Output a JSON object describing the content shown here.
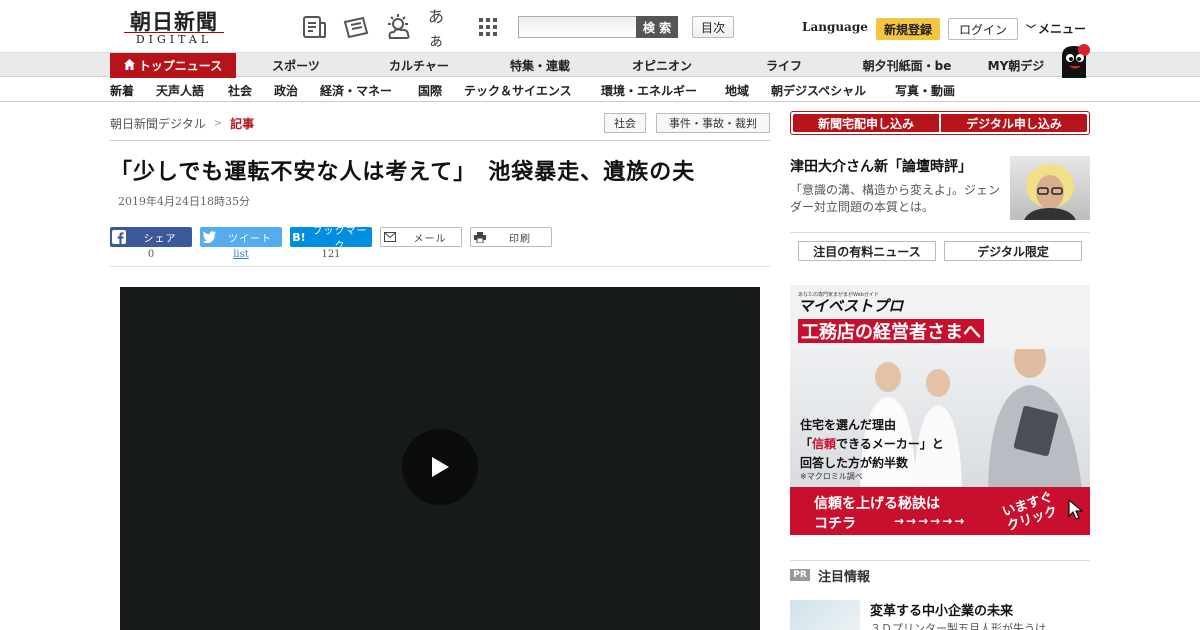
{
  "header": {
    "logo_main": "朝日新聞",
    "logo_sub": "DIGITAL",
    "icons": [
      "newspaper-icon",
      "ticket-icon",
      "weather-icon",
      "font-size-icon",
      "grid-menu-icon"
    ],
    "font_size_label": "あぁ",
    "search_button": "検 索",
    "search_placeholder": "",
    "toc_button": "目次",
    "language": "Language",
    "register_button": "新規登録",
    "login_button": "ログイン",
    "menu_button": "メニュー"
  },
  "nav_primary": {
    "items": [
      "トップニュース",
      "スポーツ",
      "カルチャー",
      "特集・連載",
      "オピニオン",
      "ライフ",
      "朝夕刊紙面・be",
      "MY朝デジ"
    ],
    "active_index": 0
  },
  "nav_secondary": {
    "items": [
      "新着",
      "天声人語",
      "社会",
      "政治",
      "経済・マネー",
      "国際",
      "テック＆サイエンス",
      "環境・エネルギー",
      "地域",
      "朝デジスペシャル",
      "写真・動画"
    ]
  },
  "breadcrumb": {
    "items": [
      "朝日新聞デジタル",
      "記事"
    ],
    "separator": ">"
  },
  "tags": [
    "社会",
    "事件・事故・裁判"
  ],
  "article": {
    "headline": "「少しでも運転不安な人は考えて」　池袋暴走、遺族の夫",
    "date": "2019年4月24日18時35分"
  },
  "share": {
    "facebook": {
      "label": "シェア",
      "count": "0"
    },
    "twitter": {
      "label": "ツイート",
      "count": "list"
    },
    "hatena": {
      "label": "ブックマーク",
      "count": "121"
    },
    "mail": {
      "label": "メール"
    },
    "print": {
      "label": "印刷"
    }
  },
  "video": {
    "play_icon": "play-icon"
  },
  "sidebar": {
    "subscribe_paper": "新聞宅配申し込み",
    "subscribe_digital": "デジタル申し込み",
    "promo": {
      "title": "津田大介さん新「論壇時評」",
      "text": "「意識の溝、構造から変えよ」。ジェンダー対立問題の本質とは。"
    },
    "tabs": [
      "注目の有料ニュース",
      "デジタル限定"
    ],
    "ad": {
      "tagline": "あなたの専門家まがまがWebガイド",
      "brand": "マイベストプロ",
      "headline": "工務店の経営者さまへ",
      "copy1": "住宅を選んだ理由",
      "copy2_pre": "「",
      "copy2_red": "信頼",
      "copy2_post": "できるメーカー」と",
      "copy3": "回答した方が約半数",
      "note": "※マクロミル調べ",
      "cta1": "信頼を上げる秘訣は",
      "cta2": "コチラ",
      "arrows": "→→→→→→",
      "click_line1": "いますぐ",
      "click_line2": "クリック"
    },
    "pr": {
      "badge": "PR",
      "label": "注目情報",
      "title": "変革する中小企業の未来",
      "sub": "３Ｄプリンター製五月人形が失うけ"
    }
  },
  "colors": {
    "brand_red": "#b6141a",
    "register_yellow": "#f5c542",
    "facebook": "#3b5998",
    "twitter": "#55acee",
    "hatena": "#008fde",
    "ad_red": "#c8102e"
  }
}
